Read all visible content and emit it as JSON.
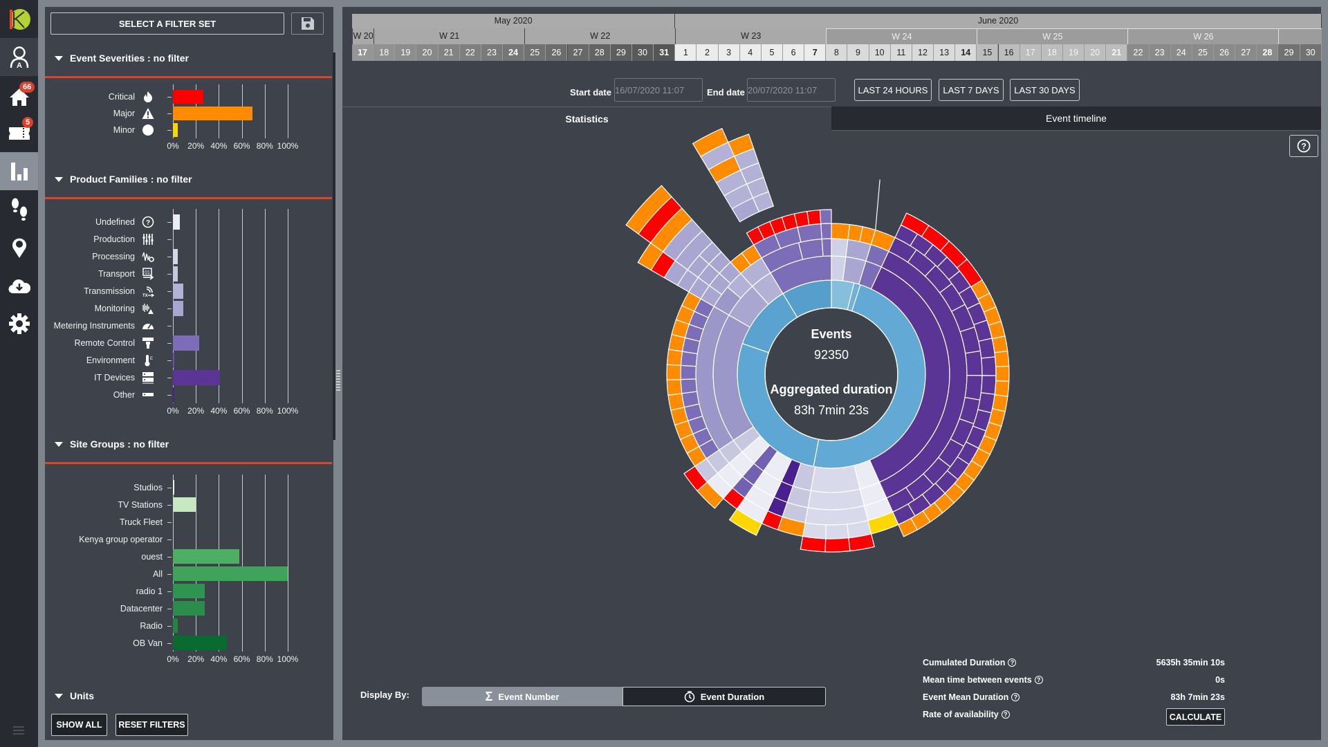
{
  "nav": {
    "items": [
      {
        "name": "logo",
        "icon": "k-logo"
      },
      {
        "name": "user-profile",
        "icon": "user-a-icon"
      },
      {
        "name": "home",
        "icon": "home-icon",
        "badge": "66"
      },
      {
        "name": "tickets",
        "icon": "ticket-icon",
        "badge": "5"
      },
      {
        "name": "statistics",
        "icon": "bar-chart-icon",
        "active": true
      },
      {
        "name": "footsteps",
        "icon": "footsteps-icon"
      },
      {
        "name": "location",
        "icon": "map-pin-icon"
      },
      {
        "name": "download",
        "icon": "cloud-download-icon"
      },
      {
        "name": "settings",
        "icon": "gear-icon"
      }
    ],
    "menu_icon": "hamburger-icon"
  },
  "filters": {
    "filterset_label": "SELECT A FILTER SET",
    "save_icon": "floppy-disk-icon",
    "severities": {
      "title": "Event Severities : no filter",
      "axis_ticks": [
        "0%",
        "20%",
        "40%",
        "60%",
        "80%",
        "100%"
      ],
      "items": [
        {
          "label": "Critical",
          "icon": "fire-icon",
          "value": 26.5,
          "color": "#ff0000"
        },
        {
          "label": "Major",
          "icon": "warning-triangle-icon",
          "value": 69,
          "color": "#ff8c00"
        },
        {
          "label": "Minor",
          "icon": "circle-icon",
          "value": 4.5,
          "color": "#ffd700"
        }
      ]
    },
    "product_families": {
      "title": "Product Families : no filter",
      "axis_ticks": [
        "0%",
        "20%",
        "40%",
        "60%",
        "80%",
        "100%"
      ],
      "items": [
        {
          "label": "Undefined",
          "icon": "question-circle-icon",
          "value": 6,
          "color": "#ececf5"
        },
        {
          "label": "Production",
          "icon": "mixer-sliders-icon",
          "value": 0,
          "color": "#e0e0ef"
        },
        {
          "label": "Processing",
          "icon": "waveform-gear-icon",
          "value": 4.5,
          "color": "#d5d6e8"
        },
        {
          "label": "Transport",
          "icon": "transport-icon",
          "value": 4.5,
          "color": "#c7c8e0"
        },
        {
          "label": "Transmission",
          "icon": "tx-antenna-icon",
          "value": 9,
          "color": "#b3b1d6"
        },
        {
          "label": "Monitoring",
          "icon": "monitoring-icon",
          "value": 9,
          "color": "#a9a6d1"
        },
        {
          "label": "Metering Instruments",
          "icon": "gauge-icon",
          "value": 0,
          "color": "#9b97c8"
        },
        {
          "label": "Remote Control",
          "icon": "remote-control-icon",
          "value": 23,
          "color": "#7c6db8"
        },
        {
          "label": "Environment",
          "icon": "thermometer-icon",
          "value": 1.5,
          "color": "#6a4fae"
        },
        {
          "label": "IT Devices",
          "icon": "server-icon",
          "value": 41,
          "color": "#5b3596"
        },
        {
          "label": "Other",
          "icon": "device-icon",
          "value": 1,
          "color": "#4a2090"
        }
      ]
    },
    "site_groups": {
      "title": "Site Groups : no filter",
      "axis_ticks": [
        "0%",
        "20%",
        "40%",
        "60%",
        "80%",
        "100%"
      ],
      "items": [
        {
          "label": "Studios",
          "value": 1.5,
          "color": "#e6f5e1"
        },
        {
          "label": "TV Stations",
          "value": 20,
          "color": "#c7e8c0"
        },
        {
          "label": "Truck Fleet",
          "value": 0,
          "color": "#a2d99b"
        },
        {
          "label": "Kenya group operator",
          "value": 0,
          "color": "#74c476"
        },
        {
          "label": "ouest",
          "value": 58,
          "color": "#4daf62"
        },
        {
          "label": "All",
          "value": 100,
          "color": "#3fa35a"
        },
        {
          "label": "radio 1",
          "value": 28,
          "color": "#2e9450"
        },
        {
          "label": "Datacenter",
          "value": 28,
          "color": "#2b8c4b"
        },
        {
          "label": "Radio",
          "value": 4.5,
          "color": "#238443"
        },
        {
          "label": "OB Van",
          "value": 47,
          "color": "#0a6b30"
        }
      ]
    },
    "units": {
      "title": "Units"
    },
    "show_all_label": "SHOW ALL",
    "reset_filters_label": "RESET FILTERS"
  },
  "calendar": {
    "months": [
      {
        "label": "May 2020",
        "days": 15
      },
      {
        "label": "June 2020",
        "days": 30
      }
    ],
    "weeks": [
      {
        "label": "W 20",
        "days": 1
      },
      {
        "label": "W 21",
        "days": 7
      },
      {
        "label": "W 22",
        "days": 7
      },
      {
        "label": "W 23",
        "days": 7
      },
      {
        "label": "W 24",
        "days": 7
      },
      {
        "label": "W 25",
        "days": 7
      },
      {
        "label": "W 26",
        "days": 7
      },
      {
        "label": "",
        "days": 2
      }
    ],
    "days": [
      "17",
      "18",
      "19",
      "20",
      "21",
      "22",
      "23",
      "24",
      "25",
      "26",
      "27",
      "28",
      "29",
      "30",
      "31",
      "1",
      "2",
      "3",
      "4",
      "5",
      "6",
      "7",
      "8",
      "9",
      "10",
      "11",
      "12",
      "13",
      "14",
      "15",
      "16",
      "17",
      "18",
      "19",
      "20",
      "21",
      "22",
      "23",
      "24",
      "25",
      "26",
      "27",
      "28",
      "29",
      "30"
    ],
    "bold_days": [
      0,
      7,
      14,
      21,
      28,
      35,
      42
    ]
  },
  "dates": {
    "start_label": "Start date",
    "start_value": "16/07/2020 11:07",
    "end_label": "End date",
    "end_value": "20/07/2020 11:07",
    "ranges": [
      "LAST 24 HOURS",
      "LAST 7 DAYS",
      "LAST 30 DAYS"
    ]
  },
  "tabs": [
    {
      "label": "Statistics",
      "active": true
    },
    {
      "label": "Event timeline",
      "active": false
    }
  ],
  "help_icon": "question-circle-icon",
  "center": {
    "events_label": "Events",
    "events_value": "92350",
    "duration_label": "Aggregated duration",
    "duration_value": "83h 7min 23s"
  },
  "display_by": {
    "label": "Display By:",
    "options": [
      {
        "label": "Event Number",
        "icon": "sigma-icon",
        "active": false
      },
      {
        "label": "Event Duration",
        "icon": "clock-icon",
        "active": true
      }
    ]
  },
  "stats": [
    {
      "label": "Cumulated Duration",
      "value": "5635h 35min 10s"
    },
    {
      "label": "Mean time between events",
      "value": "0s"
    },
    {
      "label": "Event Mean Duration",
      "value": "83h 7min 23s"
    },
    {
      "label": "Rate of availability",
      "value": null,
      "button": "CALCULATE"
    }
  ],
  "chart_data": {
    "type": "sunburst",
    "title": "",
    "center_labels": [
      "Events",
      "92350",
      "Aggregated duration",
      "83h 7min 23s"
    ],
    "angle_unit": "degrees clockwise from top",
    "rings": [
      {
        "level": 1,
        "segments": [
          {
            "start": 0,
            "end": 14,
            "color": "#86bfdc"
          },
          {
            "start": 14,
            "end": 18,
            "color": "#6fb2d9"
          },
          {
            "start": 18,
            "end": 191,
            "color": "#62a9d6"
          },
          {
            "start": 191,
            "end": 289,
            "color": "#5ea6d3"
          },
          {
            "start": 289,
            "end": 329,
            "color": "#5aa2d0"
          },
          {
            "start": 329,
            "end": 360,
            "color": "#569fcc"
          }
        ]
      },
      {
        "level": 2,
        "segments": [
          {
            "start": 0,
            "end": 7,
            "color": "#d0d0e6"
          },
          {
            "start": 7,
            "end": 17,
            "color": "#a9a6d1"
          },
          {
            "start": 17,
            "end": 25,
            "color": "#7c6db8"
          },
          {
            "start": 25,
            "end": 156,
            "color": "#5b3596"
          },
          {
            "start": 156,
            "end": 166,
            "color": "#ececf5"
          },
          {
            "start": 166,
            "end": 190,
            "color": "#d8d9ea"
          },
          {
            "start": 190,
            "end": 199,
            "color": "#c7c8e0"
          },
          {
            "start": 199,
            "end": 205,
            "color": "#4a2090"
          },
          {
            "start": 205,
            "end": 215,
            "color": "#ececf5"
          },
          {
            "start": 215,
            "end": 221,
            "color": "#7161b0"
          },
          {
            "start": 221,
            "end": 229,
            "color": "#ececf5"
          },
          {
            "start": 229,
            "end": 236,
            "color": "#c7c8e0"
          },
          {
            "start": 236,
            "end": 300,
            "color": "#9b97c8"
          },
          {
            "start": 300,
            "end": 318,
            "color": "#a9a6d1"
          },
          {
            "start": 318,
            "end": 329,
            "color": "#b3b1d6"
          },
          {
            "start": 329,
            "end": 360,
            "color": "#7c6db8"
          }
        ]
      },
      {
        "level": 3,
        "segments": [
          {
            "start": 0,
            "end": 7,
            "color": "#d0d0e6"
          },
          {
            "start": 7,
            "end": 17,
            "color": "#a9a6d1"
          },
          {
            "start": 17,
            "end": 25,
            "color": "#7c6db8"
          },
          {
            "start": 25,
            "end": 156,
            "color": "#5b3596"
          },
          {
            "start": 156,
            "end": 166,
            "color": "#ececf5"
          },
          {
            "start": 166,
            "end": 190,
            "color": "#d8d9ea"
          },
          {
            "start": 190,
            "end": 199,
            "color": "#c7c8e0"
          },
          {
            "start": 199,
            "end": 205,
            "color": "#4a2090"
          },
          {
            "start": 205,
            "end": 215,
            "color": "#ececf5"
          },
          {
            "start": 215,
            "end": 221,
            "color": "#7161b0"
          },
          {
            "start": 221,
            "end": 229,
            "color": "#ececf5"
          },
          {
            "start": 229,
            "end": 236,
            "color": "#c7c8e0"
          },
          {
            "start": 236,
            "end": 300,
            "color": "#9b97c8"
          },
          {
            "start": 300,
            "end": 310,
            "color": "#9b97c8"
          },
          {
            "start": 310,
            "end": 318,
            "color": "#b3b1d6"
          },
          {
            "start": 318,
            "end": 329,
            "color": "#b3b1d6"
          },
          {
            "start": 329,
            "end": 346,
            "color": "#7c6db8"
          },
          {
            "start": 346,
            "end": 356,
            "color": "#7c6db8"
          },
          {
            "start": 356,
            "end": 360,
            "color": "#7c6db8"
          }
        ]
      },
      {
        "level": 4,
        "segments": [
          {
            "start": 0,
            "end": 7,
            "color": "#ff8c00"
          },
          {
            "start": 7,
            "end": 12,
            "color": "#ff8c00"
          },
          {
            "start": 12,
            "end": 17,
            "color": "#ff8c00"
          },
          {
            "start": 17,
            "end": 25,
            "color": "#ff8c00"
          },
          {
            "start": 25,
            "end": 156,
            "color": "#5b3596",
            "split": 14
          },
          {
            "start": 156,
            "end": 166,
            "color": "#ececf5"
          },
          {
            "start": 166,
            "end": 190,
            "color": "#d8d9ea"
          },
          {
            "start": 190,
            "end": 199,
            "color": "#c7c8e0"
          },
          {
            "start": 199,
            "end": 205,
            "color": "#4a2090"
          },
          {
            "start": 205,
            "end": 215,
            "color": "#ececf5"
          },
          {
            "start": 215,
            "end": 221,
            "color": "#7161b0"
          },
          {
            "start": 221,
            "end": 229,
            "color": "#ececf5"
          },
          {
            "start": 229,
            "end": 236,
            "color": "#c7c8e0"
          },
          {
            "start": 236,
            "end": 300,
            "color": "#7c6db8",
            "split": 12
          },
          {
            "start": 300,
            "end": 318,
            "color": "#a9a6d1",
            "split": 3
          },
          {
            "start": 318,
            "end": 329,
            "color": "#ff8c00",
            "split": 2
          },
          {
            "start": 329,
            "end": 356,
            "color": "#7c6db8",
            "split": 3
          },
          {
            "start": 356,
            "end": 360,
            "color": "#7c6db8"
          }
        ]
      },
      {
        "level": 5,
        "segments": [
          {
            "start": 25,
            "end": 156,
            "color": "#5b3596",
            "split": 20
          },
          {
            "start": 156,
            "end": 166,
            "color": "#ffd700"
          },
          {
            "start": 166,
            "end": 190,
            "color": "#d8d9ea",
            "split": 3
          },
          {
            "start": 190,
            "end": 199,
            "color": "#ff8c00"
          },
          {
            "start": 199,
            "end": 205,
            "color": "#ff0000"
          },
          {
            "start": 205,
            "end": 215,
            "color": "#ececf5"
          },
          {
            "start": 215,
            "end": 221,
            "color": "#ff0000"
          },
          {
            "start": 221,
            "end": 229,
            "color": "#ececf5"
          },
          {
            "start": 229,
            "end": 236,
            "color": "#c7c8e0"
          },
          {
            "start": 236,
            "end": 300,
            "color": "#ff8c00",
            "split": 12
          },
          {
            "start": 300,
            "end": 318,
            "color": "#a9a6d1",
            "split": 3
          },
          {
            "start": 329,
            "end": 356,
            "color": "#ff0000",
            "split": 6
          },
          {
            "start": 356,
            "end": 360,
            "color": "#7c6db8"
          }
        ]
      },
      {
        "level": 6,
        "segments": [
          {
            "start": 25,
            "end": 58,
            "color": "#ff0000",
            "split": 4
          },
          {
            "start": 58,
            "end": 156,
            "color": "#ff8c00",
            "split": 20
          },
          {
            "start": 166,
            "end": 190,
            "color": "#ff0000",
            "split": 3
          },
          {
            "start": 205,
            "end": 215,
            "color": "#ffd700"
          },
          {
            "start": 221,
            "end": 229,
            "color": "#ff8c00"
          },
          {
            "start": 229,
            "end": 236,
            "color": "#ff0000"
          },
          {
            "start": 300,
            "end": 318,
            "color": "#a9a6d1",
            "split": 3
          }
        ]
      }
    ],
    "spikes": [
      {
        "start": 300,
        "end": 306,
        "levels": [
          [
            "#a9a6d1"
          ],
          [
            "#ff0000"
          ],
          [
            "#ff8c00"
          ]
        ]
      },
      {
        "start": 306,
        "end": 318,
        "levels": [
          [
            "#a9a6d1"
          ],
          [
            "#a9a6d1"
          ],
          [
            "#ff8c00"
          ],
          [
            "#ff0000"
          ],
          [
            "#ff8c00"
          ]
        ]
      },
      {
        "start": 329,
        "end": 336,
        "levels": [
          [
            "#a9a6d1"
          ],
          [
            "#b3b1d6"
          ],
          [
            "#b3b1d6"
          ],
          [
            "#ff8c00"
          ],
          [
            "#b3b1d6"
          ],
          [
            "#ff8c00"
          ]
        ]
      },
      {
        "start": 336,
        "end": 341,
        "levels": [
          [
            "#b3b1d6"
          ],
          [
            "#b3b1d6"
          ],
          [
            "#b3b1d6"
          ],
          [
            "#b3b1d6"
          ],
          [
            "#ff8c00"
          ]
        ]
      }
    ]
  }
}
